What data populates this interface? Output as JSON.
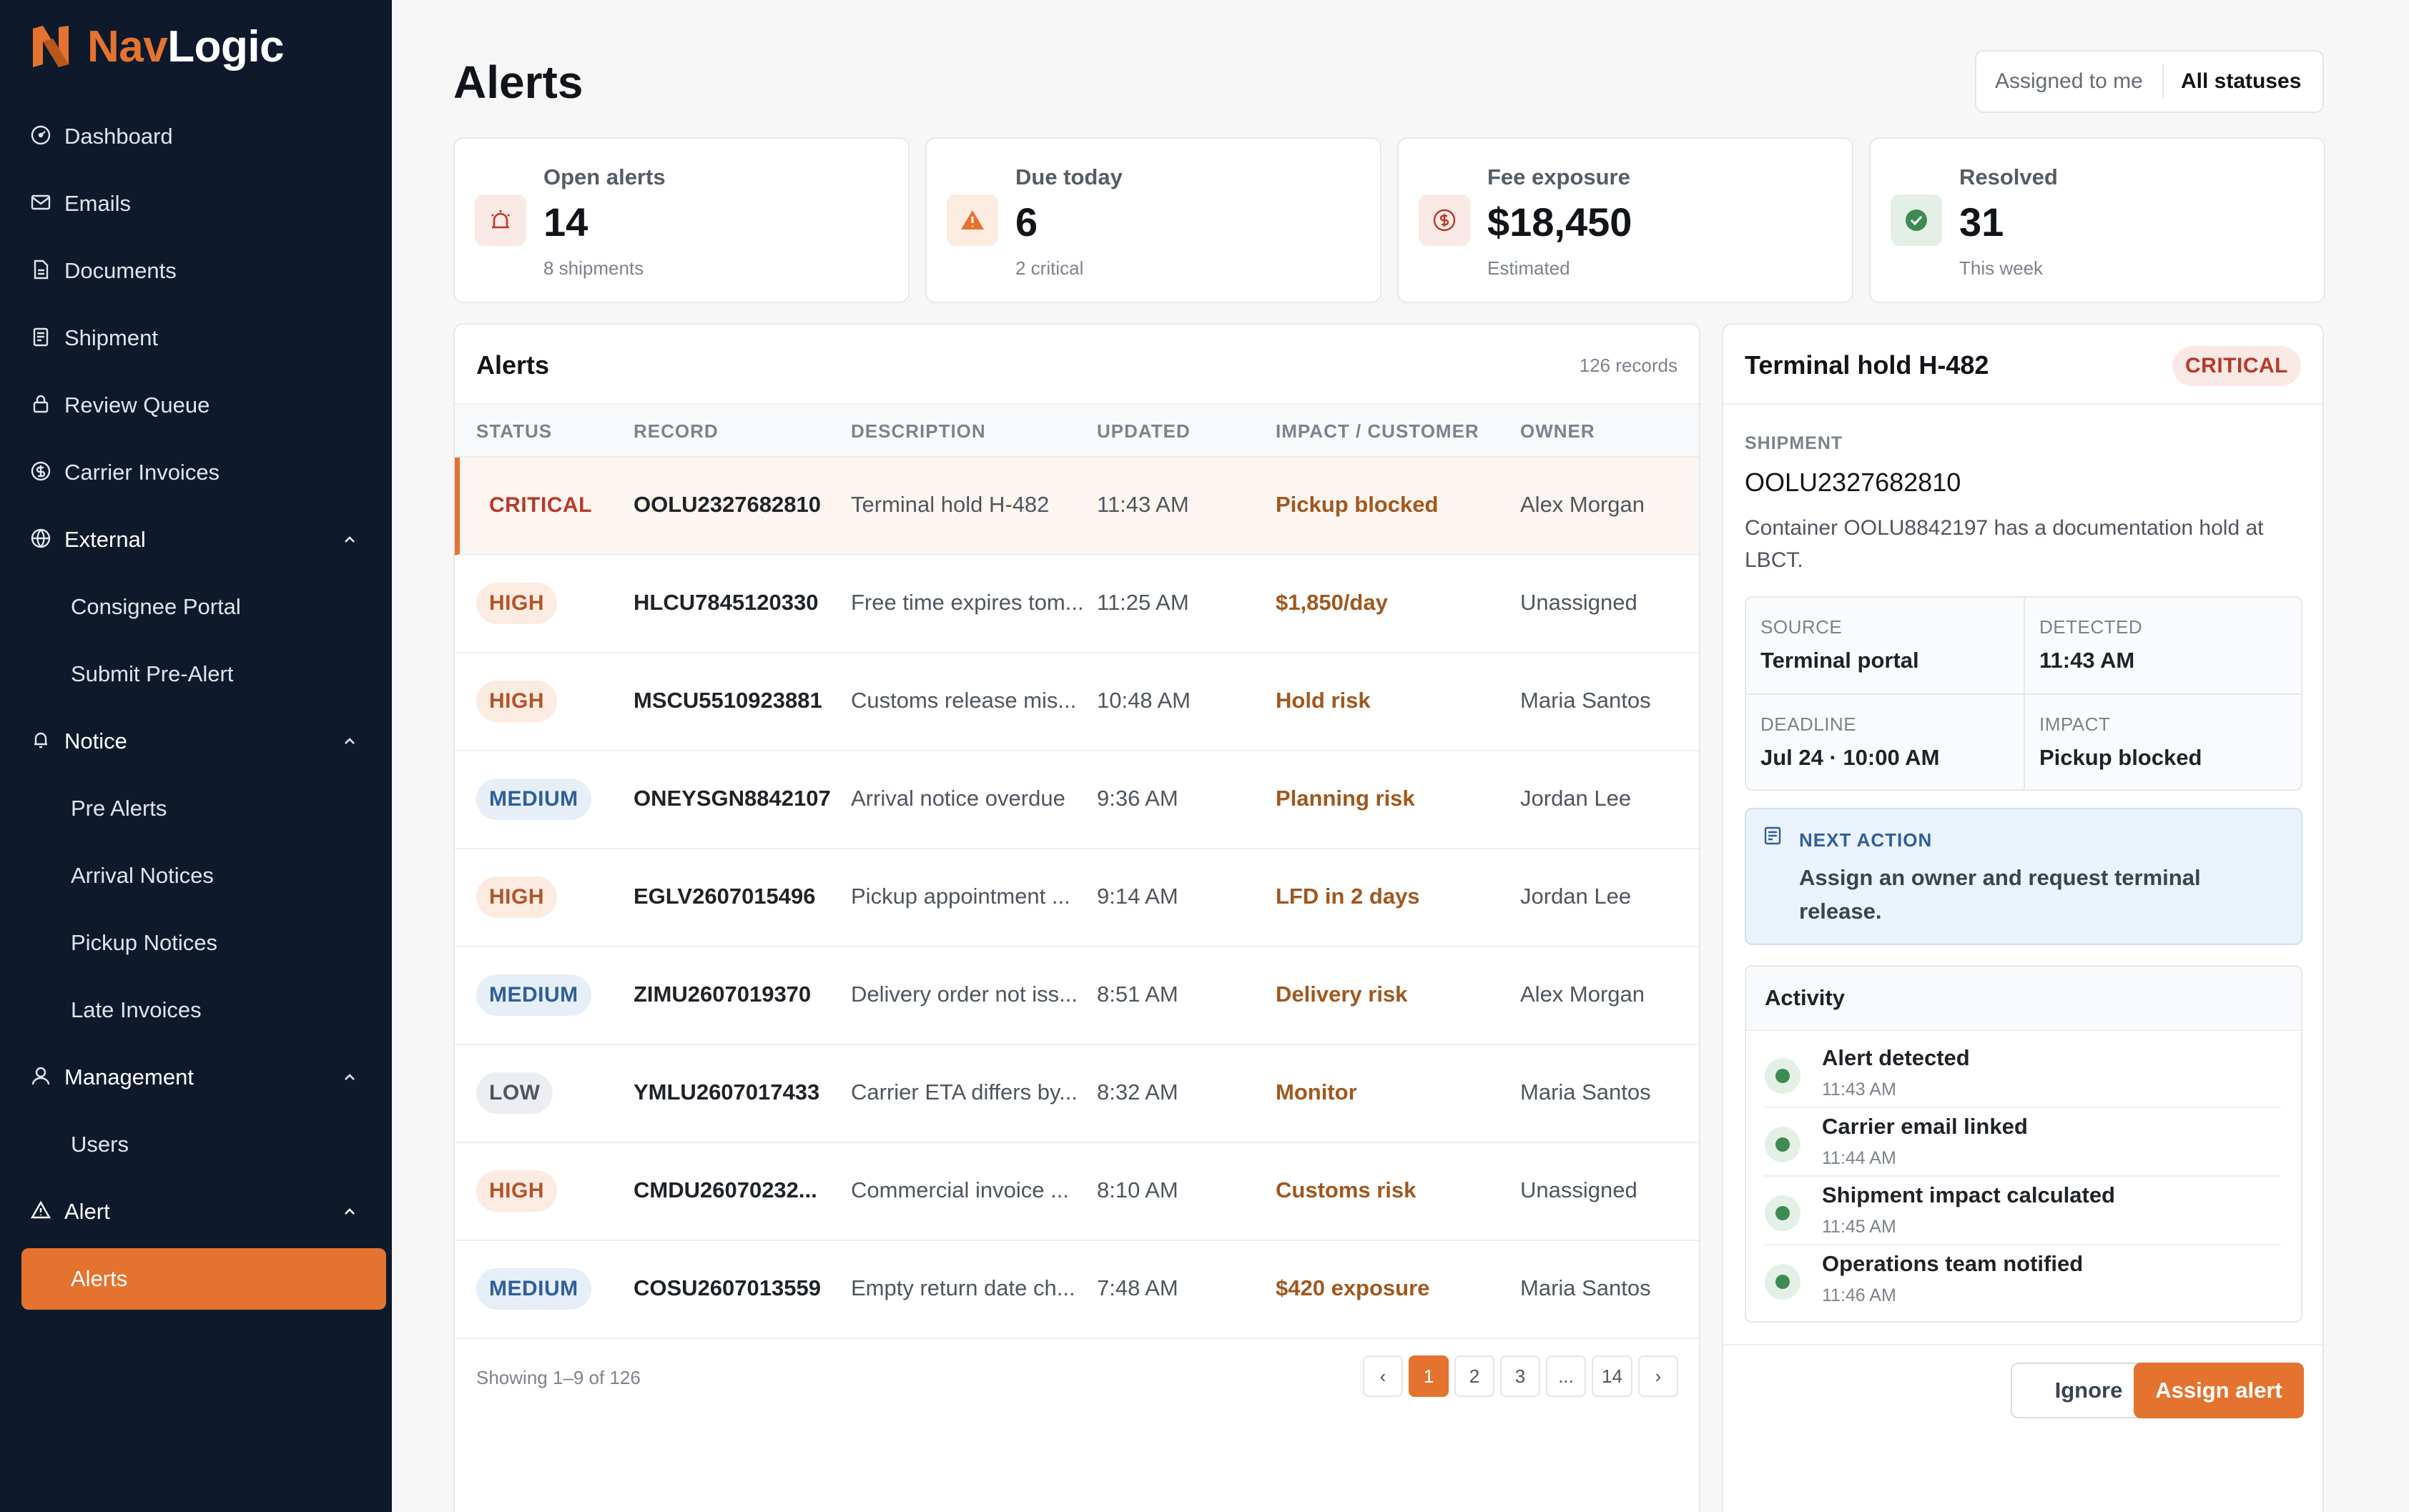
{
  "brand": {
    "name_part1": "Nav",
    "name_part2": "Logic",
    "accent": "#e4732f"
  },
  "sidebar": {
    "items": [
      {
        "label": "Dashboard",
        "icon": "dashboard-icon"
      },
      {
        "label": "Emails",
        "icon": "mail-icon"
      },
      {
        "label": "Documents",
        "icon": "document-icon"
      },
      {
        "label": "Shipment",
        "icon": "clipboard-icon"
      },
      {
        "label": "Review Queue",
        "icon": "lock-icon"
      },
      {
        "label": "Carrier Invoices",
        "icon": "dollar-circle-icon"
      }
    ],
    "groups": [
      {
        "label": "External",
        "icon": "globe-icon",
        "children": [
          "Consignee Portal",
          "Submit Pre-Alert"
        ]
      },
      {
        "label": "Notice",
        "icon": "bell-icon",
        "children": [
          "Pre Alerts",
          "Arrival Notices",
          "Pickup Notices",
          "Late Invoices"
        ]
      },
      {
        "label": "Management",
        "icon": "user-icon",
        "children": [
          "Users"
        ]
      },
      {
        "label": "Alert",
        "icon": "warning-icon",
        "children": [
          "Alerts"
        ]
      }
    ],
    "active": "Alerts"
  },
  "header": {
    "title": "Alerts",
    "filters": {
      "assigned": "Assigned to me",
      "status": "All statuses"
    }
  },
  "stats": [
    {
      "label": "Open alerts",
      "value": "14",
      "sub": "8 shipments",
      "icon": "alarm-icon"
    },
    {
      "label": "Due today",
      "value": "6",
      "sub": "2 critical",
      "icon": "warning-icon"
    },
    {
      "label": "Fee exposure",
      "value": "$18,450",
      "sub": "Estimated",
      "icon": "dollar-circle-icon"
    },
    {
      "label": "Resolved",
      "value": "31",
      "sub": "This week",
      "icon": "check-circle-icon"
    }
  ],
  "table": {
    "title": "Alerts",
    "count": "126 records",
    "columns": [
      "STATUS",
      "RECORD",
      "DESCRIPTION",
      "UPDATED",
      "IMPACT / CUSTOMER",
      "OWNER"
    ],
    "rows": [
      {
        "status": "CRITICAL",
        "record": "OOLU2327682810",
        "desc": "Terminal hold H-482",
        "updated": "11:43 AM",
        "impact": "Pickup blocked",
        "owner": "Alex Morgan"
      },
      {
        "status": "HIGH",
        "record": "HLCU7845120330",
        "desc": "Free time expires tom...",
        "updated": "11:25 AM",
        "impact": "$1,850/day",
        "owner": "Unassigned"
      },
      {
        "status": "HIGH",
        "record": "MSCU5510923881",
        "desc": "Customs release mis...",
        "updated": "10:48 AM",
        "impact": "Hold risk",
        "owner": "Maria Santos"
      },
      {
        "status": "MEDIUM",
        "record": "ONEYSGN8842107",
        "desc": "Arrival notice overdue",
        "updated": "9:36 AM",
        "impact": "Planning risk",
        "owner": "Jordan Lee"
      },
      {
        "status": "HIGH",
        "record": "EGLV2607015496",
        "desc": "Pickup appointment ...",
        "updated": "9:14 AM",
        "impact": "LFD in 2 days",
        "owner": "Jordan Lee"
      },
      {
        "status": "MEDIUM",
        "record": "ZIMU2607019370",
        "desc": "Delivery order not iss...",
        "updated": "8:51 AM",
        "impact": "Delivery risk",
        "owner": "Alex Morgan"
      },
      {
        "status": "LOW",
        "record": "YMLU2607017433",
        "desc": "Carrier ETA differs by...",
        "updated": "8:32 AM",
        "impact": "Monitor",
        "owner": "Maria Santos"
      },
      {
        "status": "HIGH",
        "record": "CMDU26070232...",
        "desc": "Commercial invoice ...",
        "updated": "8:10 AM",
        "impact": "Customs risk",
        "owner": "Unassigned"
      },
      {
        "status": "MEDIUM",
        "record": "COSU2607013559",
        "desc": "Empty return date ch...",
        "updated": "7:48 AM",
        "impact": "$420 exposure",
        "owner": "Maria Santos"
      }
    ],
    "footer": "Showing 1–9 of 126",
    "pager": [
      "‹",
      "1",
      "2",
      "3",
      "...",
      "14",
      "›"
    ],
    "current_page": "1"
  },
  "detail": {
    "title": "Terminal hold H-482",
    "badge": "CRITICAL",
    "shipment_label": "SHIPMENT",
    "shipment": "OOLU2327682810",
    "description": "Container OOLU8842197 has a documentation hold at LBCT.",
    "fields": [
      {
        "label": "SOURCE",
        "value": "Terminal portal"
      },
      {
        "label": "DETECTED",
        "value": "11:43 AM"
      },
      {
        "label": "DEADLINE",
        "value": "Jul 24 · 10:00 AM"
      },
      {
        "label": "IMPACT",
        "value": "Pickup blocked"
      }
    ],
    "next_action_label": "NEXT ACTION",
    "next_action": "Assign an owner and request terminal release.",
    "activity_title": "Activity",
    "activity": [
      {
        "title": "Alert detected",
        "time": "11:43 AM"
      },
      {
        "title": "Carrier email linked",
        "time": "11:44 AM"
      },
      {
        "title": "Shipment impact calculated",
        "time": "11:45 AM"
      },
      {
        "title": "Operations team notified",
        "time": "11:46 AM"
      }
    ],
    "ignore_label": "Ignore",
    "assign_label": "Assign alert"
  }
}
